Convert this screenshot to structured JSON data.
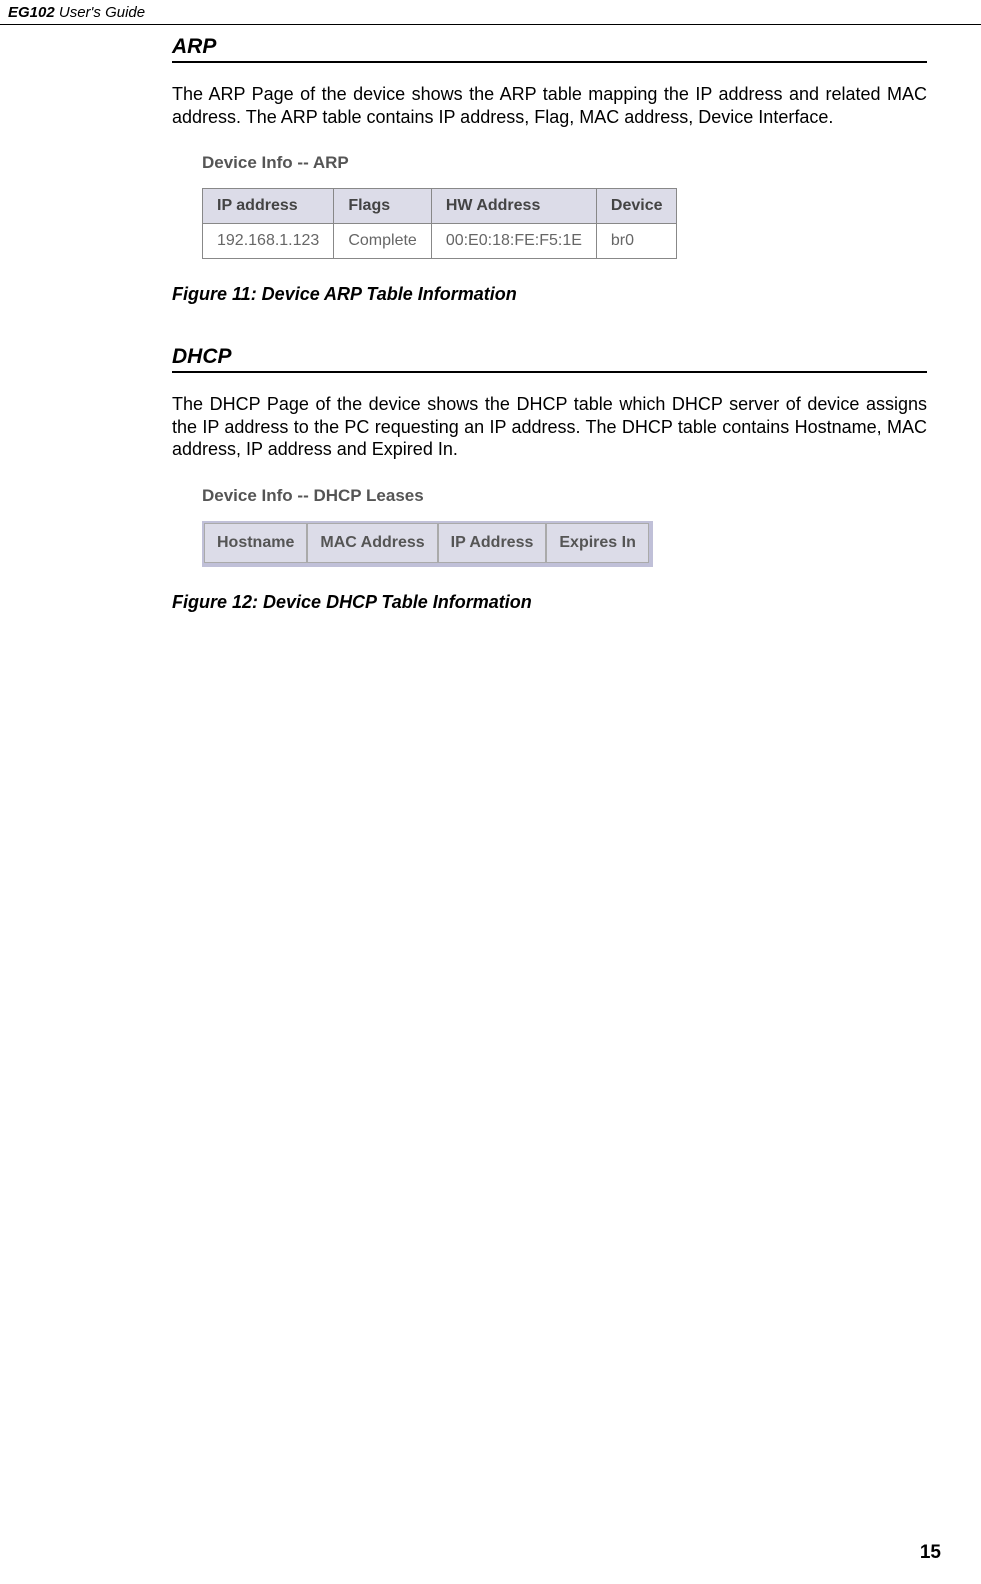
{
  "header": {
    "product": "EG102",
    "doc_title": " User's Guide"
  },
  "section_arp": {
    "title": "ARP",
    "paragraph": "The ARP Page of the device shows the ARP table mapping the IP address and related MAC address. The ARP table contains IP address, Flag, MAC address, Device Interface.",
    "figure_title": "Device Info -- ARP",
    "table": {
      "headers": [
        "IP address",
        "Flags",
        "HW Address",
        "Device"
      ],
      "rows": [
        [
          "192.168.1.123",
          "Complete",
          "00:E0:18:FE:F5:1E",
          "br0"
        ]
      ]
    },
    "figure_caption": "Figure 11: Device ARP Table Information"
  },
  "section_dhcp": {
    "title": "DHCP",
    "paragraph": "The DHCP Page of the device shows the DHCP table which DHCP server of device assigns the IP address to the PC requesting an IP address. The DHCP table contains Hostname, MAC address, IP address and Expired In.",
    "figure_title": "Device Info -- DHCP Leases",
    "table": {
      "headers": [
        "Hostname",
        "MAC Address",
        "IP Address",
        "Expires In"
      ]
    },
    "figure_caption": "Figure 12: Device DHCP Table Information"
  },
  "page_number": "15"
}
